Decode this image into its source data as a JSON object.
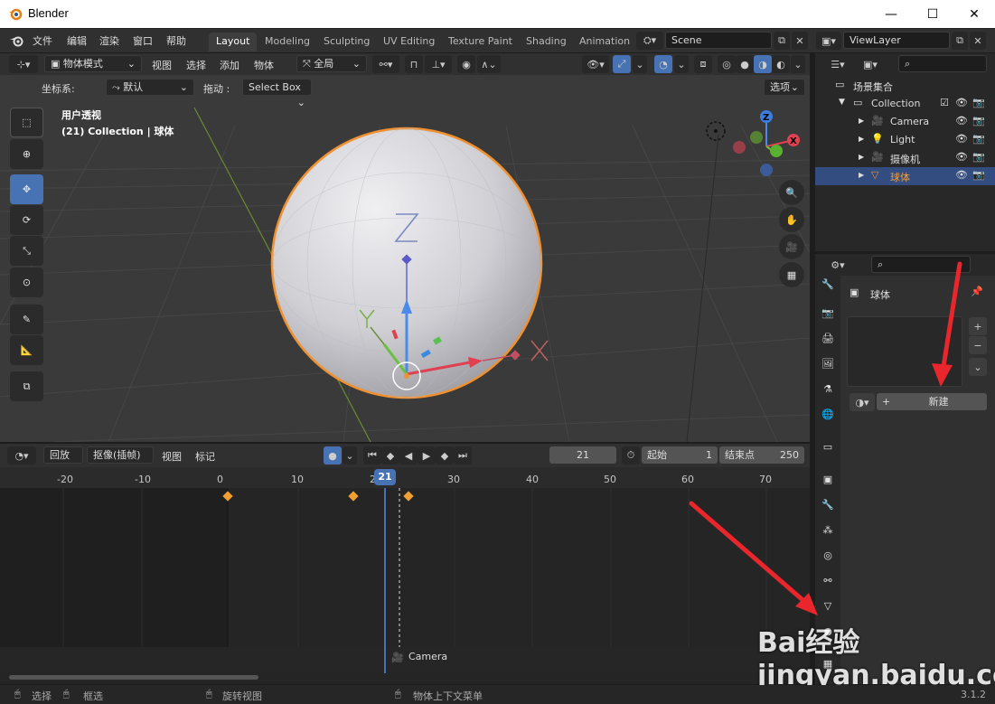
{
  "window": {
    "title": "Blender",
    "min": "—",
    "max": "☐",
    "close": "✕"
  },
  "menu": [
    "文件",
    "编辑",
    "渲染",
    "窗口",
    "帮助"
  ],
  "workspaces": [
    "Layout",
    "Modeling",
    "Sculpting",
    "UV Editing",
    "Texture Paint",
    "Shading",
    "Animation"
  ],
  "scene": "Scene",
  "viewlayer": "ViewLayer",
  "vp_header": {
    "mode": "物体模式",
    "menus": [
      "视图",
      "选择",
      "添加",
      "物体"
    ],
    "transform": "全局"
  },
  "vp_header2": {
    "coord_label": "坐标系:",
    "coord_value": "默认",
    "drag_label": "拖动 :",
    "drag_value": "Select Box",
    "options": "选项"
  },
  "vp_overlay": {
    "view_name": "用户透视",
    "collection": "(21) Collection | 球体"
  },
  "gizmo": {
    "z": "Z",
    "x": "X"
  },
  "timeline": {
    "playback": "回放",
    "keying": "抠像(插帧)",
    "view": "视图",
    "marker": "标记",
    "frame": "21",
    "start_label": "起始",
    "start": "1",
    "end_label": "结束点",
    "end": "250",
    "ticks": [
      "-20",
      "-10",
      "0",
      "10",
      "20",
      "30",
      "40",
      "50",
      "60",
      "70"
    ],
    "current": "21",
    "camera_marker": "Camera"
  },
  "outliner": {
    "root": "场景集合",
    "items": [
      {
        "label": "Collection",
        "indent": 1
      },
      {
        "label": "Camera",
        "indent": 2
      },
      {
        "label": "Light",
        "indent": 2
      },
      {
        "label": "摄像机",
        "indent": 2
      },
      {
        "label": "球体",
        "indent": 2,
        "selected": true
      }
    ]
  },
  "properties": {
    "object": "球体",
    "new_button": "新建"
  },
  "status": {
    "select": "选择",
    "box": "框选",
    "rotate": "旋转视图",
    "context": "物体上下文菜单",
    "version": "3.1.2"
  },
  "watermark": "Bai经验 jingyan.baidu.com",
  "colors": {
    "accent": "#4772b3",
    "selection": "#f09030",
    "header": "#303030",
    "viewport": "#3a3a3a"
  }
}
